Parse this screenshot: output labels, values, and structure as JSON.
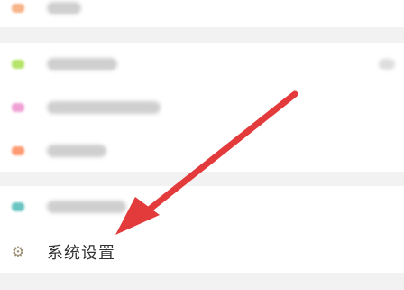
{
  "colors": {
    "background": "#f2f2f2",
    "card": "#ffffff",
    "arrow": "#e33b3b",
    "gear_icon": "#9a8a6d",
    "icon_peach": "#f8b48a",
    "icon_green": "#b5e46a",
    "icon_pink": "#f0a2d6",
    "icon_orange": "#ff9b73",
    "icon_teal": "#6bc5c2"
  },
  "menu": {
    "items": [
      {
        "name": "blurred-item-1",
        "icon": "peach-icon",
        "label_obscured": true
      },
      {
        "name": "blurred-item-2",
        "icon": "green-icon",
        "label_obscured": true,
        "has_right_value": true
      },
      {
        "name": "blurred-item-3",
        "icon": "pink-icon",
        "label_obscured": true
      },
      {
        "name": "blurred-item-4",
        "icon": "orange-icon",
        "label_obscured": true
      },
      {
        "name": "blurred-item-5",
        "icon": "teal-icon",
        "label_obscured": true
      },
      {
        "name": "system-settings",
        "icon": "gear-icon",
        "label": "系统设置"
      }
    ]
  },
  "annotation": {
    "type": "arrow",
    "target": "system-settings"
  }
}
